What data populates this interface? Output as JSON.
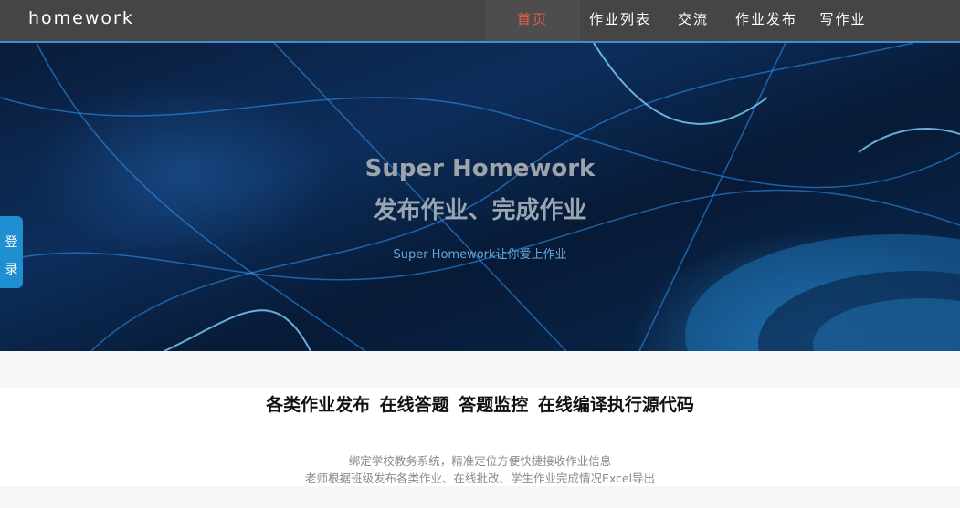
{
  "navbar": {
    "brand": "homework",
    "items": [
      {
        "label": "首页"
      },
      {
        "label": "作业列表"
      },
      {
        "label": "交流"
      },
      {
        "label": "作业发布"
      },
      {
        "label": "写作业"
      }
    ]
  },
  "hero": {
    "title": "Super Homework",
    "subtitle": "发布作业、完成作业",
    "tagline": "Super Homework让你爱上作业"
  },
  "login": {
    "char1": "登",
    "char2": "录"
  },
  "features": {
    "title": "各类作业发布  在线答题  答题监控  在线编译执行源代码",
    "desc_line1": "绑定学校教务系统，精准定位方便快捷接收作业信息",
    "desc_line2": "老师根据班级发布各类作业、在线批改、学生作业完成情况Excel导出"
  },
  "colors": {
    "navbar_bg": "#454545",
    "nav_active_text": "#e95a4e",
    "accent": "#3a8fd6",
    "login_tab": "#1f8fd1"
  }
}
